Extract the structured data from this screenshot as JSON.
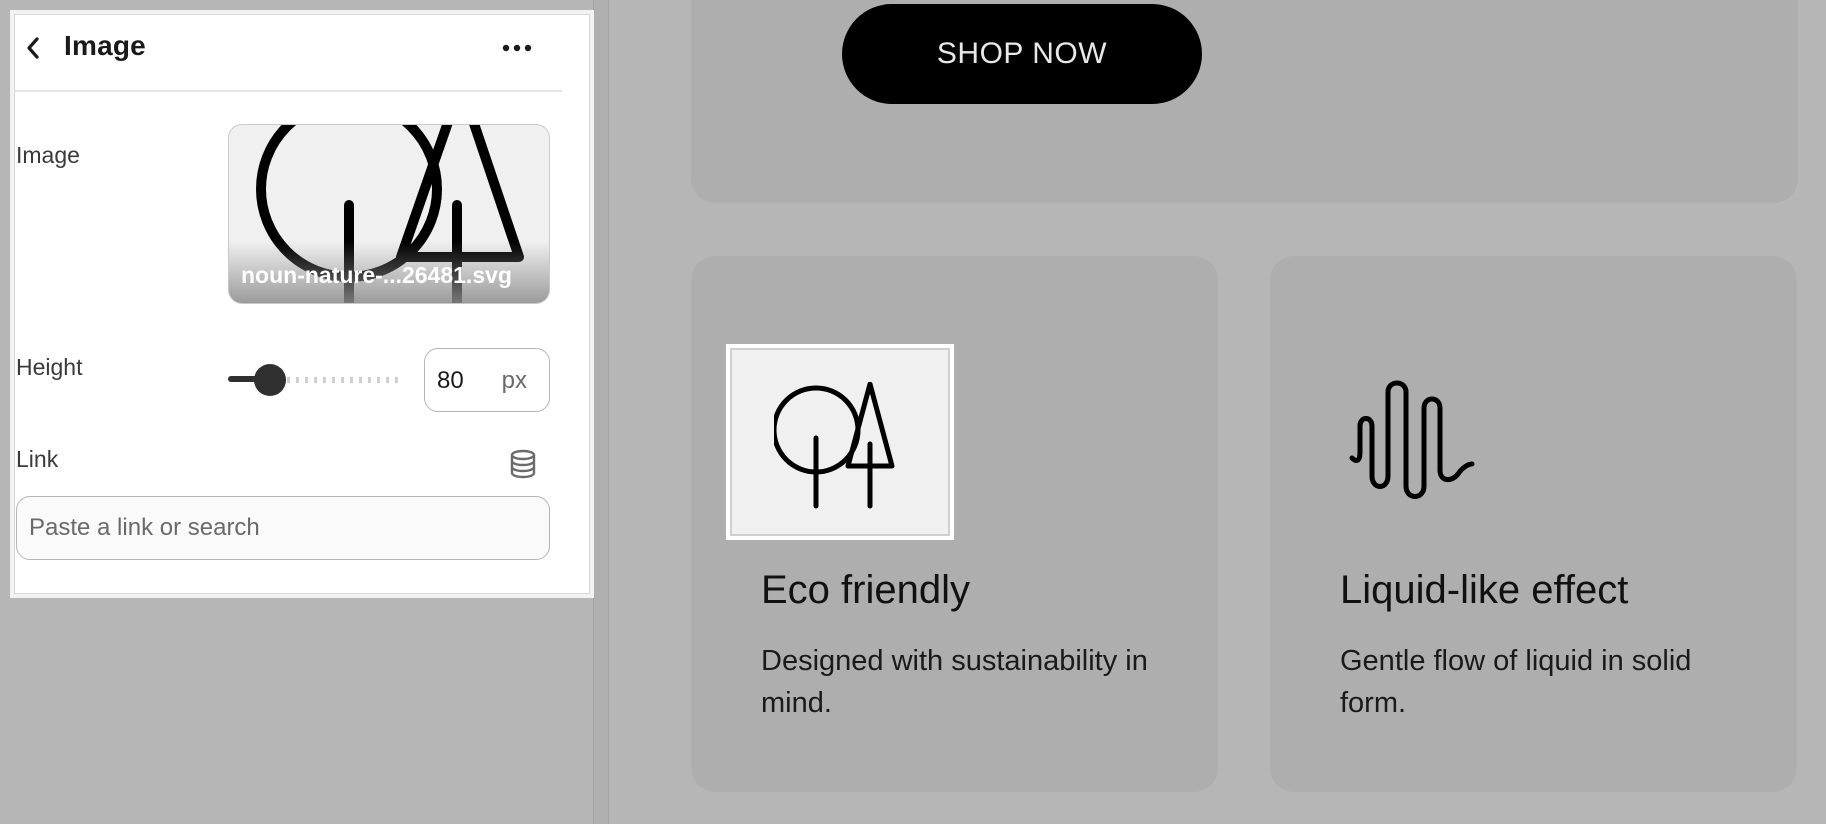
{
  "panel": {
    "title": "Image",
    "fields": {
      "image_label": "Image",
      "image_filename": "noun-nature-...26481.svg",
      "height_label": "Height",
      "height_value": "80",
      "height_unit": "px",
      "height_slider_fraction": 0.2,
      "link_label": "Link",
      "link_placeholder": "Paste a link or search"
    }
  },
  "preview": {
    "shop_button": "SHOP NOW",
    "features": [
      {
        "icon": "trees-icon",
        "title": "Eco friendly",
        "text": "Designed with sustainability in mind."
      },
      {
        "icon": "wave-icon",
        "title": "Liquid-like effect",
        "text": "Gentle flow of liquid in solid form."
      }
    ]
  },
  "icons": {
    "back": "chevron-left-icon",
    "more": "more-horizontal-icon",
    "data_source": "database-icon"
  },
  "colors": {
    "button_bg": "#000000",
    "card_bg": "#aeaeae",
    "page_bg": "#b6b6b6"
  }
}
